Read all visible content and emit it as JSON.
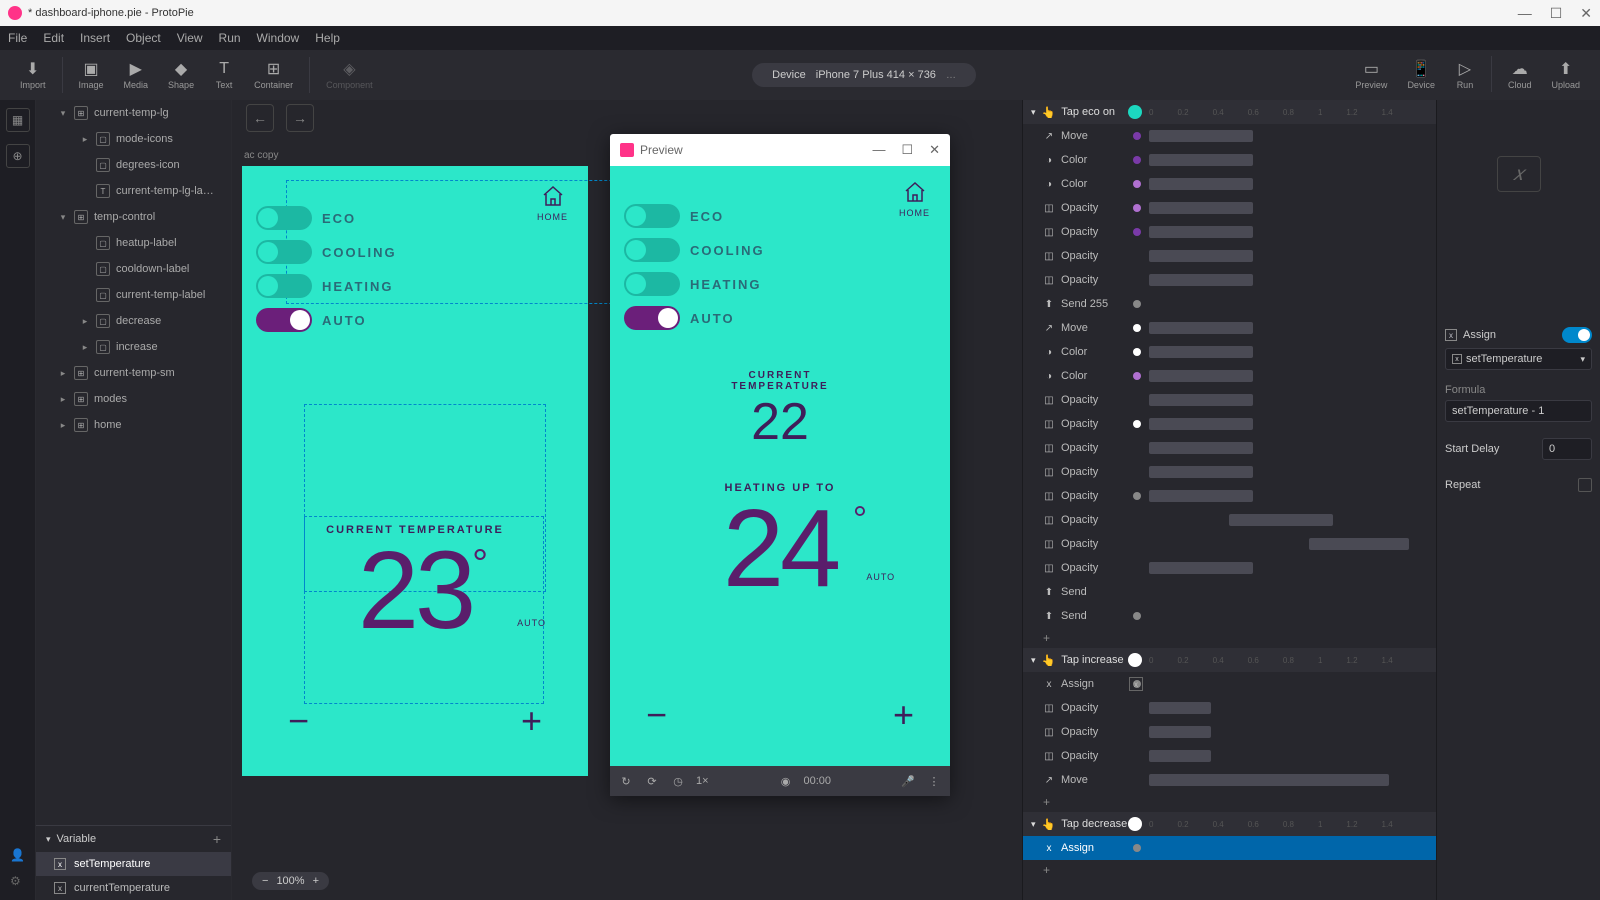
{
  "titlebar": {
    "filename": "* dashboard-iphone.pie",
    "app": "ProtoPie"
  },
  "menu": [
    "File",
    "Edit",
    "Insert",
    "Object",
    "View",
    "Run",
    "Window",
    "Help"
  ],
  "toolbar": {
    "left": [
      "Import",
      "Image",
      "Media",
      "Shape",
      "Text",
      "Container",
      "Component"
    ],
    "device_label": "Device",
    "device_value": "iPhone 7 Plus  414 × 736",
    "right": [
      "Preview",
      "Device",
      "Run",
      "Cloud",
      "Upload"
    ]
  },
  "layers": [
    {
      "name": "current-temp-lg",
      "depth": 0,
      "expand": "▾",
      "icon": "grp"
    },
    {
      "name": "mode-icons",
      "depth": 1,
      "expand": "▸",
      "icon": "img"
    },
    {
      "name": "degrees-icon",
      "depth": 1,
      "expand": "",
      "icon": "img"
    },
    {
      "name": "current-temp-lg-la…",
      "depth": 1,
      "expand": "",
      "icon": "T"
    },
    {
      "name": "temp-control",
      "depth": 0,
      "expand": "▾",
      "icon": "grp"
    },
    {
      "name": "heatup-label",
      "depth": 1,
      "expand": "",
      "icon": "img"
    },
    {
      "name": "cooldown-label",
      "depth": 1,
      "expand": "",
      "icon": "img"
    },
    {
      "name": "current-temp-label",
      "depth": 1,
      "expand": "",
      "icon": "img"
    },
    {
      "name": "decrease",
      "depth": 1,
      "expand": "▸",
      "icon": "img"
    },
    {
      "name": "increase",
      "depth": 1,
      "expand": "▸",
      "icon": "img"
    },
    {
      "name": "current-temp-sm",
      "depth": 0,
      "expand": "▸",
      "icon": "grp"
    },
    {
      "name": "modes",
      "depth": 0,
      "expand": "▸",
      "icon": "grp"
    },
    {
      "name": "home",
      "depth": 0,
      "expand": "▸",
      "icon": "grp"
    }
  ],
  "variables": {
    "header": "Variable",
    "items": [
      "setTemperature",
      "currentTemperature"
    ],
    "selected": 0
  },
  "canvas": {
    "scene_label": "ac copy",
    "zoom": "100%"
  },
  "artboard": {
    "home_label": "HOME",
    "modes": [
      {
        "label": "ECO",
        "on": false
      },
      {
        "label": "COOLING",
        "on": false
      },
      {
        "label": "HEATING",
        "on": false
      },
      {
        "label": "AUTO",
        "on": true
      }
    ],
    "current_label": "CURRENT TEMPERATURE",
    "temp": "23",
    "mode_small": "AUTO"
  },
  "preview": {
    "title": "Preview",
    "home_label": "HOME",
    "modes": [
      {
        "label": "ECO",
        "on": false
      },
      {
        "label": "COOLING",
        "on": false
      },
      {
        "label": "HEATING",
        "on": false
      },
      {
        "label": "AUTO",
        "on": true
      }
    ],
    "current_label_1": "CURRENT",
    "current_label_2": "TEMPERATURE",
    "current_temp": "22",
    "heating_label": "HEATING UP TO",
    "heating_temp": "24",
    "mode_small": "AUTO",
    "time": "00:00",
    "speed": "1×"
  },
  "ruler_ticks": [
    "0",
    "0.2",
    "0.4",
    "0.6",
    "0.8",
    "1",
    "1.2",
    "1.4"
  ],
  "triggers": [
    {
      "name": "Tap eco on",
      "dot_color": "#1cd8c0",
      "responses": [
        {
          "name": "Move",
          "marker": "#7a3aa8",
          "bar": [
            126,
            104
          ]
        },
        {
          "name": "Color",
          "marker": "#7a3aa8",
          "bar": [
            126,
            104
          ]
        },
        {
          "name": "Color",
          "marker": "#b070d0",
          "bar": [
            126,
            104
          ]
        },
        {
          "name": "Opacity",
          "marker": "#b070d0",
          "bar": [
            126,
            104
          ]
        },
        {
          "name": "Opacity",
          "marker": "#7a3aa8",
          "bar": [
            126,
            104
          ]
        },
        {
          "name": "Opacity",
          "marker": "",
          "bar": [
            126,
            104
          ]
        },
        {
          "name": "Opacity",
          "marker": "",
          "bar": [
            126,
            104
          ]
        },
        {
          "name": "Send 255",
          "marker": "#888",
          "bar": [
            0,
            0
          ]
        },
        {
          "name": "Move",
          "marker": "#fff",
          "bar": [
            126,
            104
          ]
        },
        {
          "name": "Color",
          "marker": "#fff",
          "bar": [
            126,
            104
          ]
        },
        {
          "name": "Color",
          "marker": "#b070d0",
          "bar": [
            126,
            104
          ]
        },
        {
          "name": "Opacity",
          "marker": "",
          "bar": [
            126,
            104
          ]
        },
        {
          "name": "Opacity",
          "marker": "#fff",
          "bar": [
            126,
            104
          ]
        },
        {
          "name": "Opacity",
          "marker": "",
          "bar": [
            126,
            104
          ]
        },
        {
          "name": "Opacity",
          "marker": "",
          "bar": [
            126,
            104
          ]
        },
        {
          "name": "Opacity",
          "marker": "#888",
          "bar": [
            126,
            104
          ]
        },
        {
          "name": "Opacity",
          "marker": "",
          "bar": [
            206,
            104
          ]
        },
        {
          "name": "Opacity",
          "marker": "",
          "bar": [
            286,
            100
          ]
        },
        {
          "name": "Opacity",
          "marker": "",
          "bar": [
            126,
            104
          ]
        },
        {
          "name": "Send",
          "marker": "",
          "bar": [
            0,
            0
          ]
        },
        {
          "name": "Send",
          "marker": "#888",
          "bar": [
            0,
            0
          ]
        }
      ]
    },
    {
      "name": "Tap increase",
      "dot_color": "#fff",
      "responses": [
        {
          "name": "Assign",
          "marker": "#888",
          "bar": [
            0,
            0
          ],
          "rico": "x"
        },
        {
          "name": "Opacity",
          "marker": "",
          "bar": [
            126,
            62
          ]
        },
        {
          "name": "Opacity",
          "marker": "",
          "bar": [
            126,
            62
          ]
        },
        {
          "name": "Opacity",
          "marker": "",
          "bar": [
            126,
            62
          ]
        },
        {
          "name": "Move",
          "marker": "T",
          "bar": [
            126,
            240
          ]
        }
      ]
    },
    {
      "name": "Tap decrease",
      "dot_color": "#fff",
      "responses": [
        {
          "name": "Assign",
          "marker": "#888",
          "bar": [
            0,
            0
          ],
          "selected": true,
          "rico": "x"
        }
      ]
    }
  ],
  "properties": {
    "assign_label": "Assign",
    "variable": "setTemperature",
    "formula_label": "Formula",
    "formula": "setTemperature - 1",
    "delay_label": "Start Delay",
    "delay": "0",
    "repeat_label": "Repeat"
  }
}
